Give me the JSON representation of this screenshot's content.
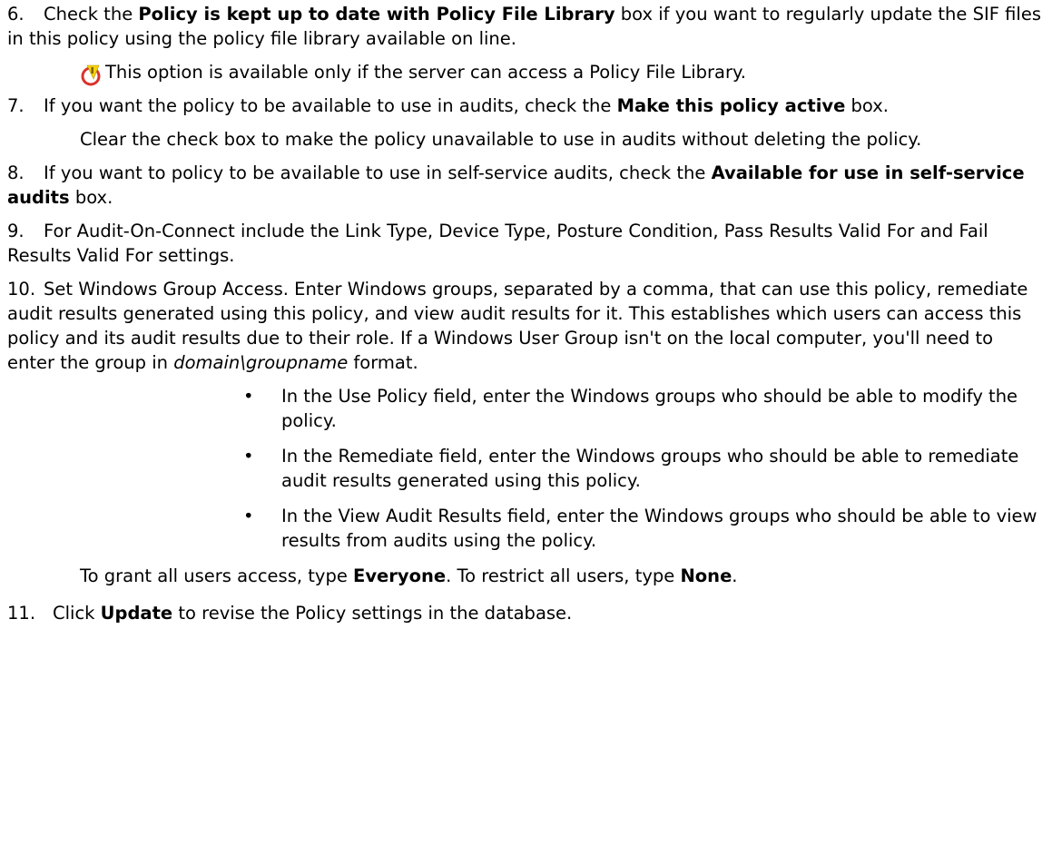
{
  "steps": [
    {
      "number": "6.",
      "parts": [
        "Check the ",
        "Policy is kept up to date with Policy File Library",
        " box if you want to regularly update the SIF files in this policy using the policy file library available on line."
      ],
      "note": "This option is available only if the server can access a Policy File Library."
    },
    {
      "number": "7.",
      "parts": [
        "If you want the policy to be available to use in audits, check the ",
        "Make this policy active",
        " box."
      ],
      "detail": "Clear the check box to make the policy unavailable to use in audits without deleting the policy."
    },
    {
      "number": "8.",
      "parts": [
        "If you want to policy to be available to use in self-service audits, check the ",
        "Available for use in self-service audits",
        " box."
      ]
    },
    {
      "number": "9.",
      "text": "For Audit-On-Connect include the Link Type, Device Type, Posture Condition, Pass Results Valid For and Fail Results Valid For settings."
    },
    {
      "number": "10.",
      "text_before": "Set Windows Group Access. Enter Windows groups, separated by a comma, that can use this policy, remediate audit results generated using this policy, and view audit results for it. This establishes which users can access this policy and its audit results due to their role. If a Windows User Group isn't on the local computer, you'll need to enter the group in ",
      "italic": "domain\\groupname",
      "text_after": " format.",
      "bullets": [
        "In the Use Policy field, enter the Windows groups who should be able to modify the policy.",
        "In the Remediate field, enter the Windows groups who should be able to remediate audit results generated using this policy.",
        "In the View Audit Results field, enter the Windows groups who should be able to view results from audits using the policy."
      ],
      "grant_parts": [
        "To grant all users access, type ",
        "Everyone",
        ". To restrict all users, type ",
        "None",
        "."
      ]
    },
    {
      "number": "11.",
      "parts": [
        "Click ",
        "Update",
        " to revise the Policy settings in the database."
      ]
    }
  ],
  "icons": {
    "note": "caution-icon"
  },
  "colors": {
    "caution_ring": "#d9342b",
    "caution_fill": "#f5d20a"
  }
}
